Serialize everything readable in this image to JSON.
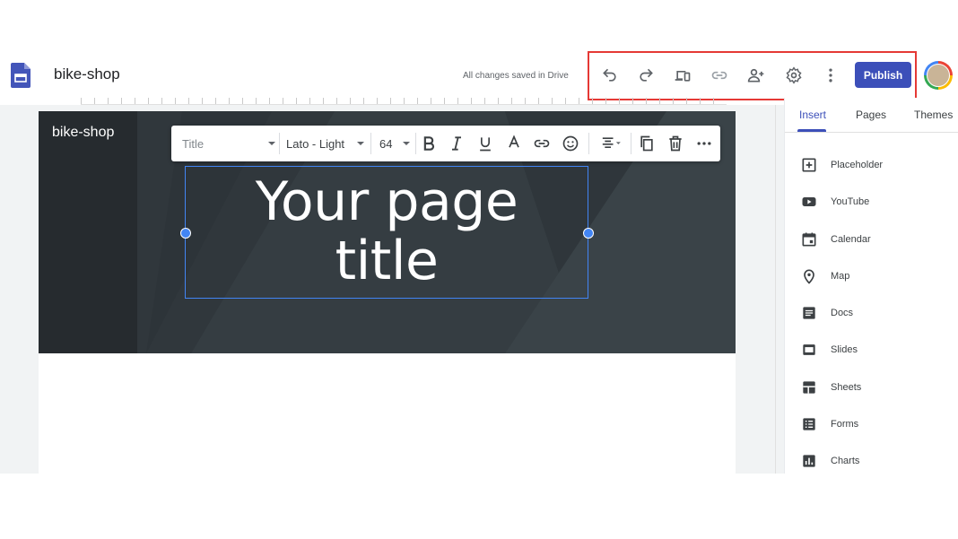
{
  "header": {
    "doc_title": "bike-shop",
    "save_status": "All changes saved in Drive",
    "publish_label": "Publish"
  },
  "toolbar_icons": [
    "undo-icon",
    "redo-icon",
    "preview-icon",
    "link-icon",
    "share-icon",
    "settings-icon",
    "more-vert-icon"
  ],
  "page": {
    "site_name": "bike-shop",
    "title_line1": "Your page",
    "title_line2": "title"
  },
  "format_toolbar": {
    "style_value": "Title",
    "font_value": "Lato - Light",
    "size_value": "64",
    "icons": [
      "bold-icon",
      "italic-icon",
      "underline-icon",
      "text-color-icon",
      "link-icon",
      "emoji-icon",
      "align-icon",
      "duplicate-icon",
      "delete-icon",
      "more-horiz-icon"
    ]
  },
  "panel": {
    "tabs": [
      {
        "label": "Insert",
        "active": true
      },
      {
        "label": "Pages",
        "active": false
      },
      {
        "label": "Themes",
        "active": false
      }
    ],
    "items": [
      {
        "label": "Placeholder",
        "icon": "placeholder-icon"
      },
      {
        "label": "YouTube",
        "icon": "youtube-icon"
      },
      {
        "label": "Calendar",
        "icon": "calendar-icon"
      },
      {
        "label": "Map",
        "icon": "map-icon"
      },
      {
        "label": "Docs",
        "icon": "docs-icon"
      },
      {
        "label": "Slides",
        "icon": "slides-icon"
      },
      {
        "label": "Sheets",
        "icon": "sheets-icon"
      },
      {
        "label": "Forms",
        "icon": "forms-icon"
      },
      {
        "label": "Charts",
        "icon": "charts-icon"
      }
    ]
  },
  "colors": {
    "accent": "#3c4fb9",
    "highlight": "#e53935",
    "selection": "#4285f4",
    "header_bg": "#2b3136"
  }
}
